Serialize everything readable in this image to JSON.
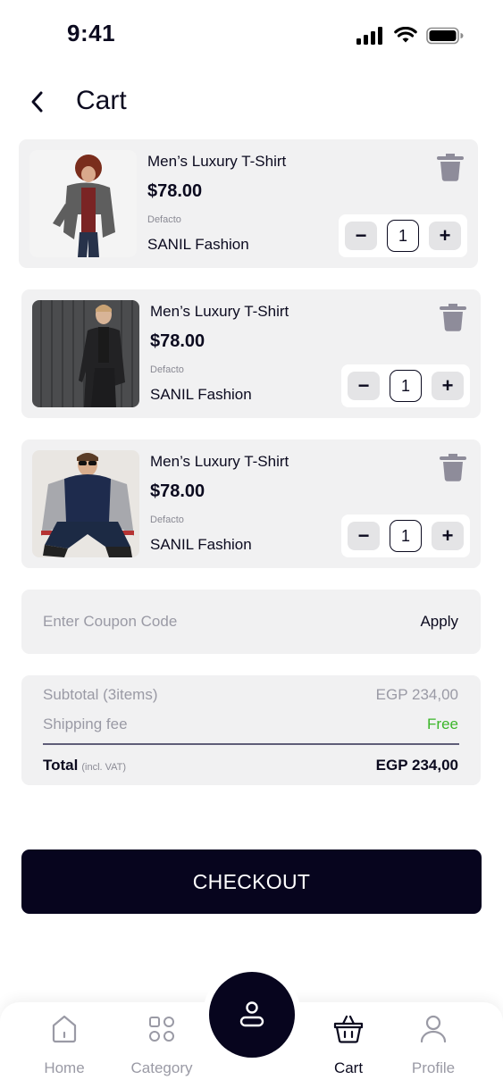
{
  "status_bar": {
    "time": "9:41",
    "icons": [
      "cellular-signal-icon",
      "wifi-icon",
      "battery-icon"
    ]
  },
  "header": {
    "back_icon": "chevron-left-icon",
    "title": "Cart"
  },
  "cart_items": [
    {
      "image": "man-grey-blazer-red-shirt-photo",
      "name": "Men’s Luxury T-Shirt",
      "price": "$78.00",
      "brand": "Defacto",
      "seller": "SANIL Fashion",
      "quantity": "1",
      "minus_label": "−",
      "plus_label": "+"
    },
    {
      "image": "man-dark-blazer-grey-wall-photo",
      "name": "Men’s Luxury T-Shirt",
      "price": "$78.00",
      "brand": "Defacto",
      "seller": "SANIL Fashion",
      "quantity": "1",
      "minus_label": "−",
      "plus_label": "+"
    },
    {
      "image": "man-varsity-jacket-sunglasses-photo",
      "name": "Men’s Luxury T-Shirt",
      "price": "$78.00",
      "brand": "Defacto",
      "seller": "SANIL Fashion",
      "quantity": "1",
      "minus_label": "−",
      "plus_label": "+"
    }
  ],
  "coupon": {
    "placeholder": "Enter Coupon Code",
    "value": "",
    "apply_label": "Apply"
  },
  "summary": {
    "subtotal_label": "Subtotal (3items)",
    "subtotal_value": "EGP 234,00",
    "shipping_label": "Shipping fee",
    "shipping_value": "Free",
    "total_label": "Total",
    "total_note": "(incl. VAT)",
    "total_value": "EGP 234,00"
  },
  "checkout": {
    "label": "CHECKOUT"
  },
  "bottom_nav": {
    "items": [
      {
        "label": "Home",
        "icon": "home-icon",
        "active": false
      },
      {
        "label": "Category",
        "icon": "grid-icon",
        "active": false
      },
      {
        "label": "Cart",
        "icon": "basket-icon",
        "active": true
      },
      {
        "label": "Profile",
        "icon": "user-icon",
        "active": false
      }
    ],
    "center_icon": "person-icon"
  },
  "colors": {
    "primary": "#07051e",
    "card_bg": "#f1f1f2",
    "muted_text": "#9a9aa5",
    "free_green": "#3cb62a"
  }
}
